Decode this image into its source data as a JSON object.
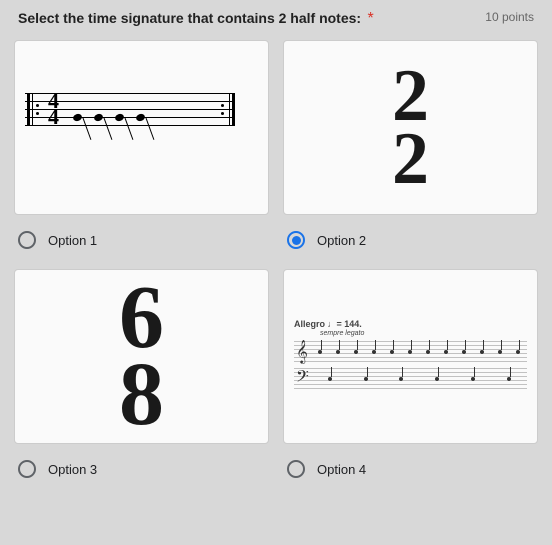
{
  "question": {
    "text": "Select the time signature that contains 2 half notes:",
    "required": "*",
    "points": "10 points"
  },
  "options": [
    {
      "label": "Option 1",
      "selected": false,
      "image": {
        "type": "staff_44",
        "ts_top": "4",
        "ts_bot": "4"
      }
    },
    {
      "label": "Option 2",
      "selected": true,
      "image": {
        "type": "ts_22",
        "top": "2",
        "bot": "2"
      }
    },
    {
      "label": "Option 3",
      "selected": false,
      "image": {
        "type": "ts_68",
        "top": "6",
        "bot": "8"
      }
    },
    {
      "label": "Option 4",
      "selected": false,
      "image": {
        "type": "sheet",
        "title": "Allegro ♩= 144.",
        "sub": "sempre legato"
      }
    }
  ]
}
